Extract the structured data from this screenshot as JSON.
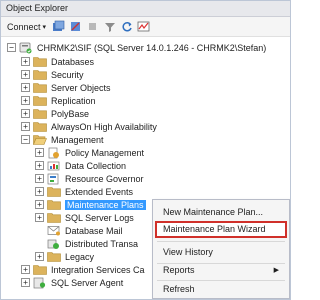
{
  "panel": {
    "title": "Object Explorer"
  },
  "toolbar": {
    "connect_label": "Connect"
  },
  "server": {
    "label": "CHRMK2\\SIF (SQL Server 14.0.1.246 - CHRMK2\\Stefan)"
  },
  "tree": {
    "databases": "Databases",
    "security": "Security",
    "server_objects": "Server Objects",
    "replication": "Replication",
    "polybase": "PolyBase",
    "alwayson": "AlwaysOn High Availability",
    "management": "Management",
    "policy_management": "Policy Management",
    "data_collection": "Data Collection",
    "resource_governor": "Resource Governor",
    "extended_events": "Extended Events",
    "maintenance_plans": "Maintenance Plans",
    "sql_server_logs": "SQL Server Logs",
    "database_mail": "Database Mail",
    "distributed_transactions": "Distributed Transa",
    "legacy": "Legacy",
    "integration_services": "Integration Services Ca",
    "sql_server_agent": "SQL Server Agent"
  },
  "context_menu": {
    "new_maintenance_plan": "New Maintenance Plan...",
    "maintenance_plan_wizard": "Maintenance Plan Wizard",
    "view_history": "View History",
    "reports": "Reports",
    "refresh": "Refresh"
  },
  "colors": {
    "selection": "#3399ff",
    "highlight_border": "#d0302a",
    "folder": "#dcb35c"
  }
}
